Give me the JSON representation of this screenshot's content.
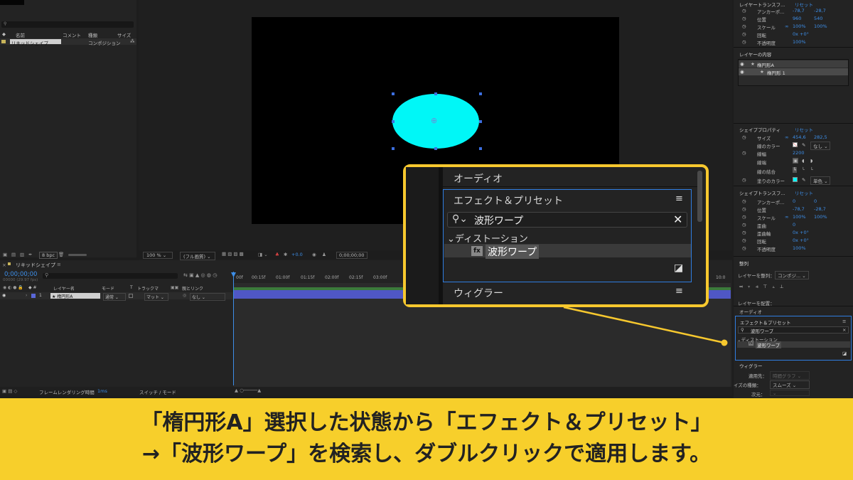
{
  "project": {
    "search_placeholder": "",
    "columns": [
      "名前",
      "コメント",
      "種類",
      "サイズ"
    ],
    "row": {
      "name": "リキッドシェイプ",
      "type": "コンポジション"
    },
    "bpc": "8 bpc"
  },
  "viewer": {
    "zoom": "100 %",
    "quality": "(フル画質)",
    "exposure": "+0.0",
    "timecode": "0;00;00;00",
    "ellipse_color": "#00f7f7"
  },
  "timeline": {
    "comp_tab": "リキッドシェイプ",
    "current_time": "0;00;00;00",
    "fps": "00000 (29.97 fps)",
    "columns": [
      "レイヤー名",
      "モード",
      "T",
      "トラックマ",
      "親とリンク"
    ],
    "ruler": [
      "00f",
      "00:15f",
      "01:00f",
      "01:15f",
      "02:00f",
      "02:15f",
      "03:00f",
      "10:0"
    ],
    "layer": {
      "num": "1",
      "name": "楕円形A",
      "mode": "通常",
      "matte": "マット",
      "parent": "なし"
    },
    "footer": {
      "render_label": "フレームレンダリング時間",
      "render_value": "1ms",
      "switch_label": "スイッチ / モード"
    }
  },
  "right_panel": {
    "layer_transform": {
      "title": "レイヤートランスフ...",
      "reset": "リセット",
      "rows": [
        {
          "label": "アンカーポ...",
          "v1": "-78,7",
          "v2": "-28,7"
        },
        {
          "label": "位置",
          "v1": "960",
          "v2": "540"
        },
        {
          "label": "スケール",
          "v1": "100%",
          "v2": "100%"
        },
        {
          "label": "回転",
          "v1": "0x +0°",
          "v2": ""
        },
        {
          "label": "不透明度",
          "v1": "100%",
          "v2": ""
        }
      ]
    },
    "layer_content": {
      "title": "レイヤーの内容",
      "items": [
        "楕円形A",
        "楕円形 1"
      ]
    },
    "shape_props": {
      "title": "シェイププロパティ",
      "reset": "リセット",
      "size_label": "サイズ",
      "size_w": "454,6",
      "size_h": "282,5",
      "stroke_color_label": "線のカラー",
      "stroke_none": "なし",
      "stroke_width_label": "線幅",
      "stroke_width": "2200",
      "cap_label": "線端",
      "join_label": "線の結合",
      "fill_label": "塗りのカラー",
      "fill_mode": "単色"
    },
    "shape_transform": {
      "title": "シェイプトランスフ...",
      "reset": "リセット",
      "rows": [
        {
          "label": "アンカーポ...",
          "v1": "0",
          "v2": "0"
        },
        {
          "label": "位置",
          "v1": "-78,7",
          "v2": "-28,7"
        },
        {
          "label": "スケール",
          "v1": "100%",
          "v2": "100%"
        },
        {
          "label": "歪曲",
          "v1": "0",
          "v2": ""
        },
        {
          "label": "歪曲軸",
          "v1": "0x +0°",
          "v2": ""
        },
        {
          "label": "回転",
          "v1": "0x +0°",
          "v2": ""
        },
        {
          "label": "不透明度",
          "v1": "100%",
          "v2": ""
        }
      ]
    },
    "align": {
      "title": "整列",
      "align_to_label": "レイヤーを整列：",
      "align_to_value": "コンポジ...",
      "distribute_label": "レイヤーを配置："
    },
    "audio_label": "オーディオ",
    "effects": {
      "title": "エフェクト＆プリセット",
      "search": "波形ワープ",
      "category": "ディストーション",
      "item": "波形ワープ"
    },
    "wiggler": {
      "title": "ウィグラー",
      "apply_label": "適用先：",
      "apply_value": "時間グラフ",
      "noise_label": "イズの種類：",
      "noise_value": "スムーズ",
      "dim_label": "次元："
    }
  },
  "callout": {
    "audio": "オーディオ",
    "effects_title": "エフェクト＆プリセット",
    "search": "波形ワープ",
    "category": "ディストーション",
    "item": "波形ワープ",
    "wiggler": "ウィグラー",
    "border_color": "#f7c82e"
  },
  "caption": {
    "line1": "「楕円形A」選択した状態から「エフェクト＆プリセット」",
    "line2": "→「波形ワープ」を検索し、ダブルクリックで適用します。",
    "bg_color": "#f7cf2b"
  }
}
